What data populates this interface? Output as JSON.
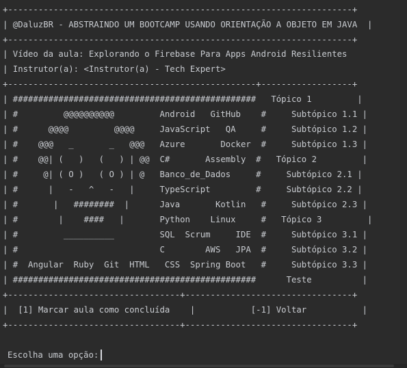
{
  "screen": {
    "lines": [
      "+--------------------------------------------------------------------+",
      "| @DaluzBR - ABSTRAINDO UM BOOTCAMP USANDO ORIENTAÇÃO A OBJETO EM JAVA  |",
      "+--------------------------------------------------------------------+",
      "| Vídeo da aula: Explorando o Firebase Para Apps Android Resilientes",
      "| Instrutor(a): <Instrutor(a) - Tech Expert>",
      "+-------------------------------------------------+------------------+",
      "| ################################################   Tópico 1         |",
      "| #         @@@@@@@@@@         Android   GitHub    #     Subtópico 1.1 |",
      "| #      @@@@         @@@@     JavaScript   QA     #     Subtópico 1.2 |",
      "| #    @@@   _       _   @@@   Azure       Docker  #     Subtópico 1.3 |",
      "| #    @@| (   )   (   ) | @@  C#       Assembly  #   Tópico 2         |",
      "| #     @| ( O )   ( O ) | @   Banco_de_Dados     #     Subtópico 2.1 |",
      "| #      |   -   ^   -   |     TypeScript         #     Subtópico 2.2 |",
      "| #       |   ########  |      Java       Kotlin   #     Subtópico 2.3 |",
      "| #        |    ####   |       Python    Linux     #   Tópico 3         |",
      "| #         __________         SQL  Scrum     IDE  #     Subtópico 3.1 |",
      "| #                            C        AWS   JPA  #     Subtópico 3.2 |",
      "| #  Angular  Ruby  Git  HTML   CSS  Spring Boot   #     Subtópico 3.3 |",
      "| ################################################      Teste          |",
      "+----------------------------------+---------------------------------+",
      "|  [1] Marcar aula como concluída    |           [-1] Voltar           |",
      "+----------------------------------+---------------------------------+"
    ],
    "prompt": "Escolha uma opção:"
  }
}
